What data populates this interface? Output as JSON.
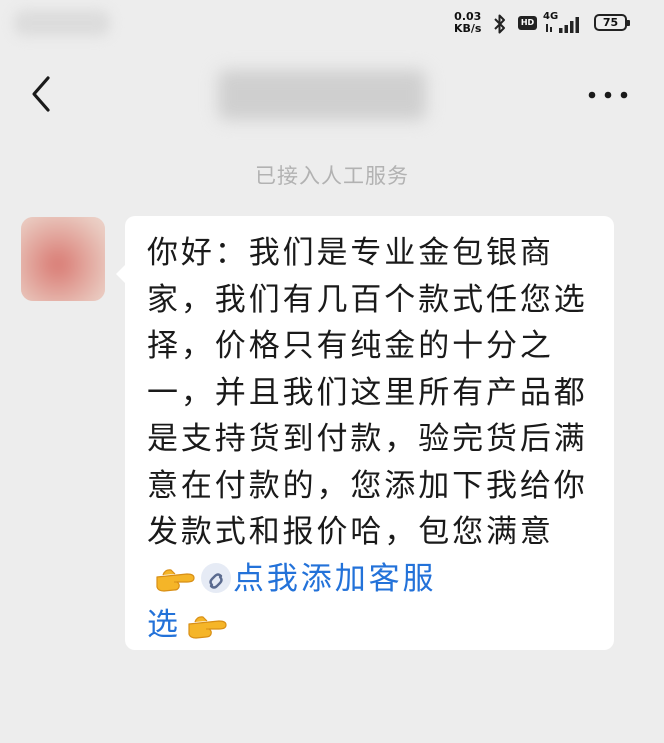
{
  "status_bar": {
    "net_speed_value": "0.03",
    "net_speed_unit": "KB/s",
    "hd_label": "HD",
    "network_label": "4G",
    "battery_level": "75"
  },
  "nav": {
    "back_icon": "chevron-left-icon",
    "more_icon": "more-dots-icon"
  },
  "chat": {
    "system_notice": "已接入人工服务",
    "message": {
      "text": "你好：我们是专业金包银商家，我们有几百个款式任您选择，价格只有纯金的十分之一，并且我们这里所有产品都是支持货到付款，验完货后满意在付款的，您添加下我给你发款式和报价哈，包您满意",
      "link_text": "点我添加客服",
      "link_tail": "选",
      "icons": [
        "pointing-right-hand-icon",
        "mini-program-link-icon",
        "pointing-right-hand-icon"
      ]
    }
  }
}
